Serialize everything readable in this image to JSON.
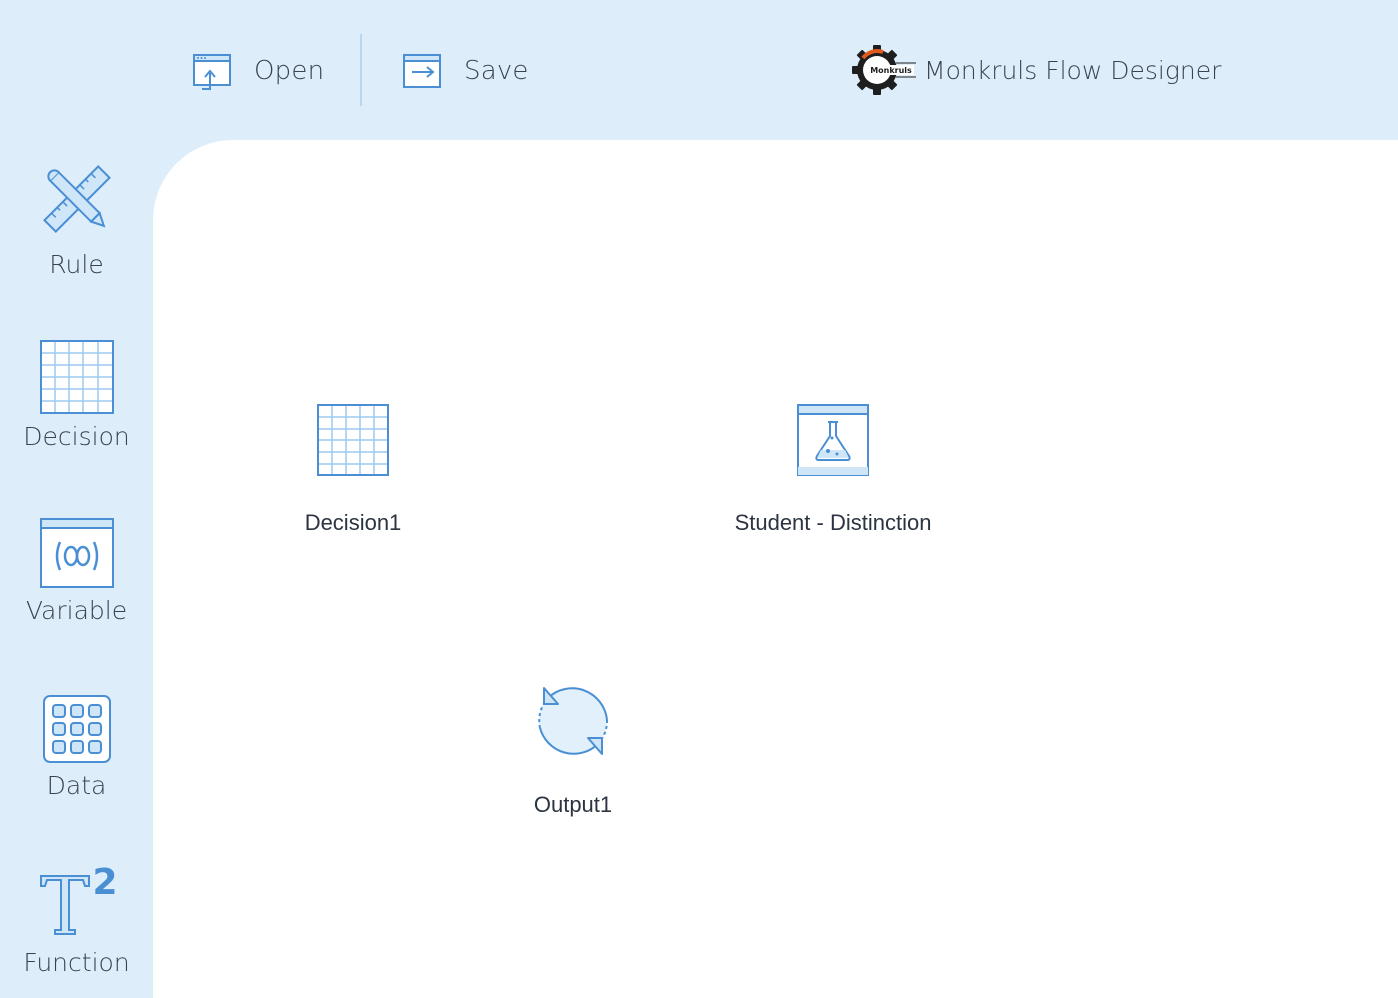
{
  "toolbar": {
    "open_label": "Open",
    "save_label": "Save",
    "brand_logo_text": "Monkruls",
    "app_title": "Monkruls Flow Designer"
  },
  "sidebar": {
    "items": [
      {
        "label": "Rule",
        "icon": "pencil-ruler-icon"
      },
      {
        "label": "Decision",
        "icon": "grid-table-icon"
      },
      {
        "label": "Variable",
        "icon": "variable-icon"
      },
      {
        "label": "Data",
        "icon": "data-grid-icon"
      },
      {
        "label": "Function",
        "icon": "function-icon"
      }
    ]
  },
  "canvas": {
    "nodes": [
      {
        "label": "Decision1",
        "icon": "grid-table-icon"
      },
      {
        "label": "Student - Distinction",
        "icon": "flask-icon"
      },
      {
        "label": "Output1",
        "icon": "refresh-cycle-icon"
      }
    ]
  },
  "colors": {
    "background": "#ddeefa",
    "canvas": "#ffffff",
    "accent": "#4a8fd4",
    "accent_fill": "#cfe6f8"
  }
}
